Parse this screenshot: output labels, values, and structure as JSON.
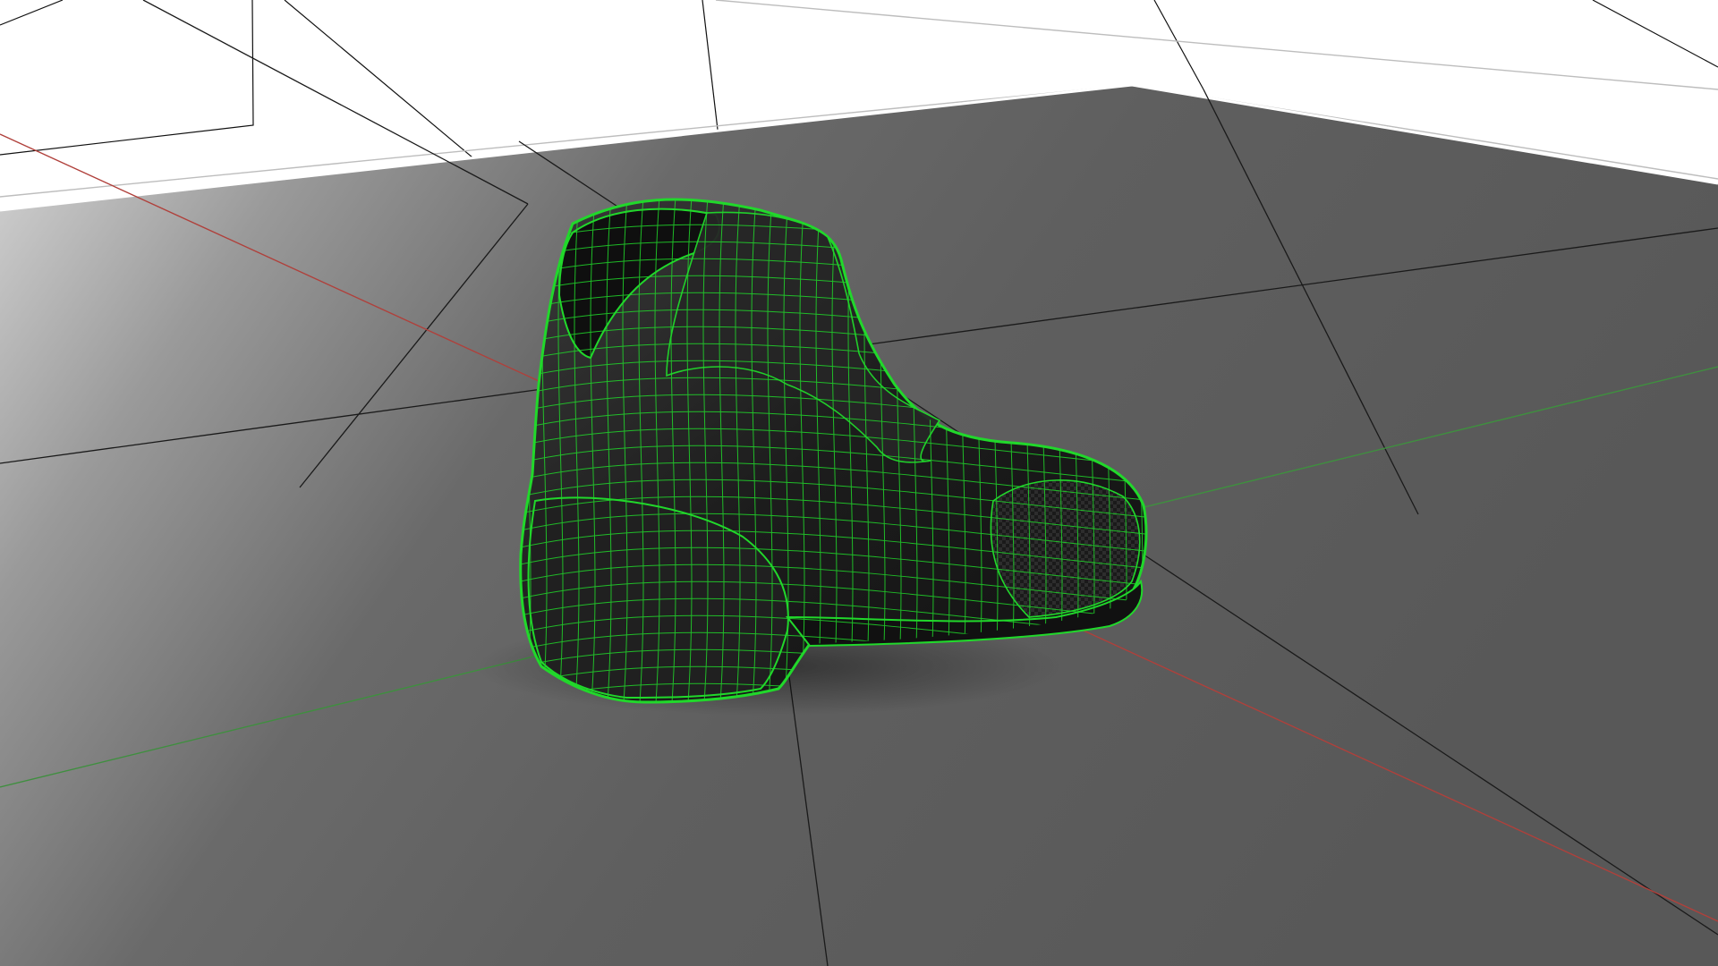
{
  "viewport": {
    "view": "perspective",
    "shading": "shaded-with-wireframe",
    "background_color": "#ffffff",
    "ground_color": "#5e5e5e",
    "grid_line_color": "#111111",
    "x_axis_color": "#b0403b",
    "y_axis_color": "#3f8f3f"
  },
  "object": {
    "type": "boot",
    "selected": true,
    "selection_color": "#21d82b",
    "material_color": "#1e1e1e"
  },
  "icons": {
    "object_icon": "boot-model-icon",
    "ground_icon": "ground-plane-icon"
  }
}
